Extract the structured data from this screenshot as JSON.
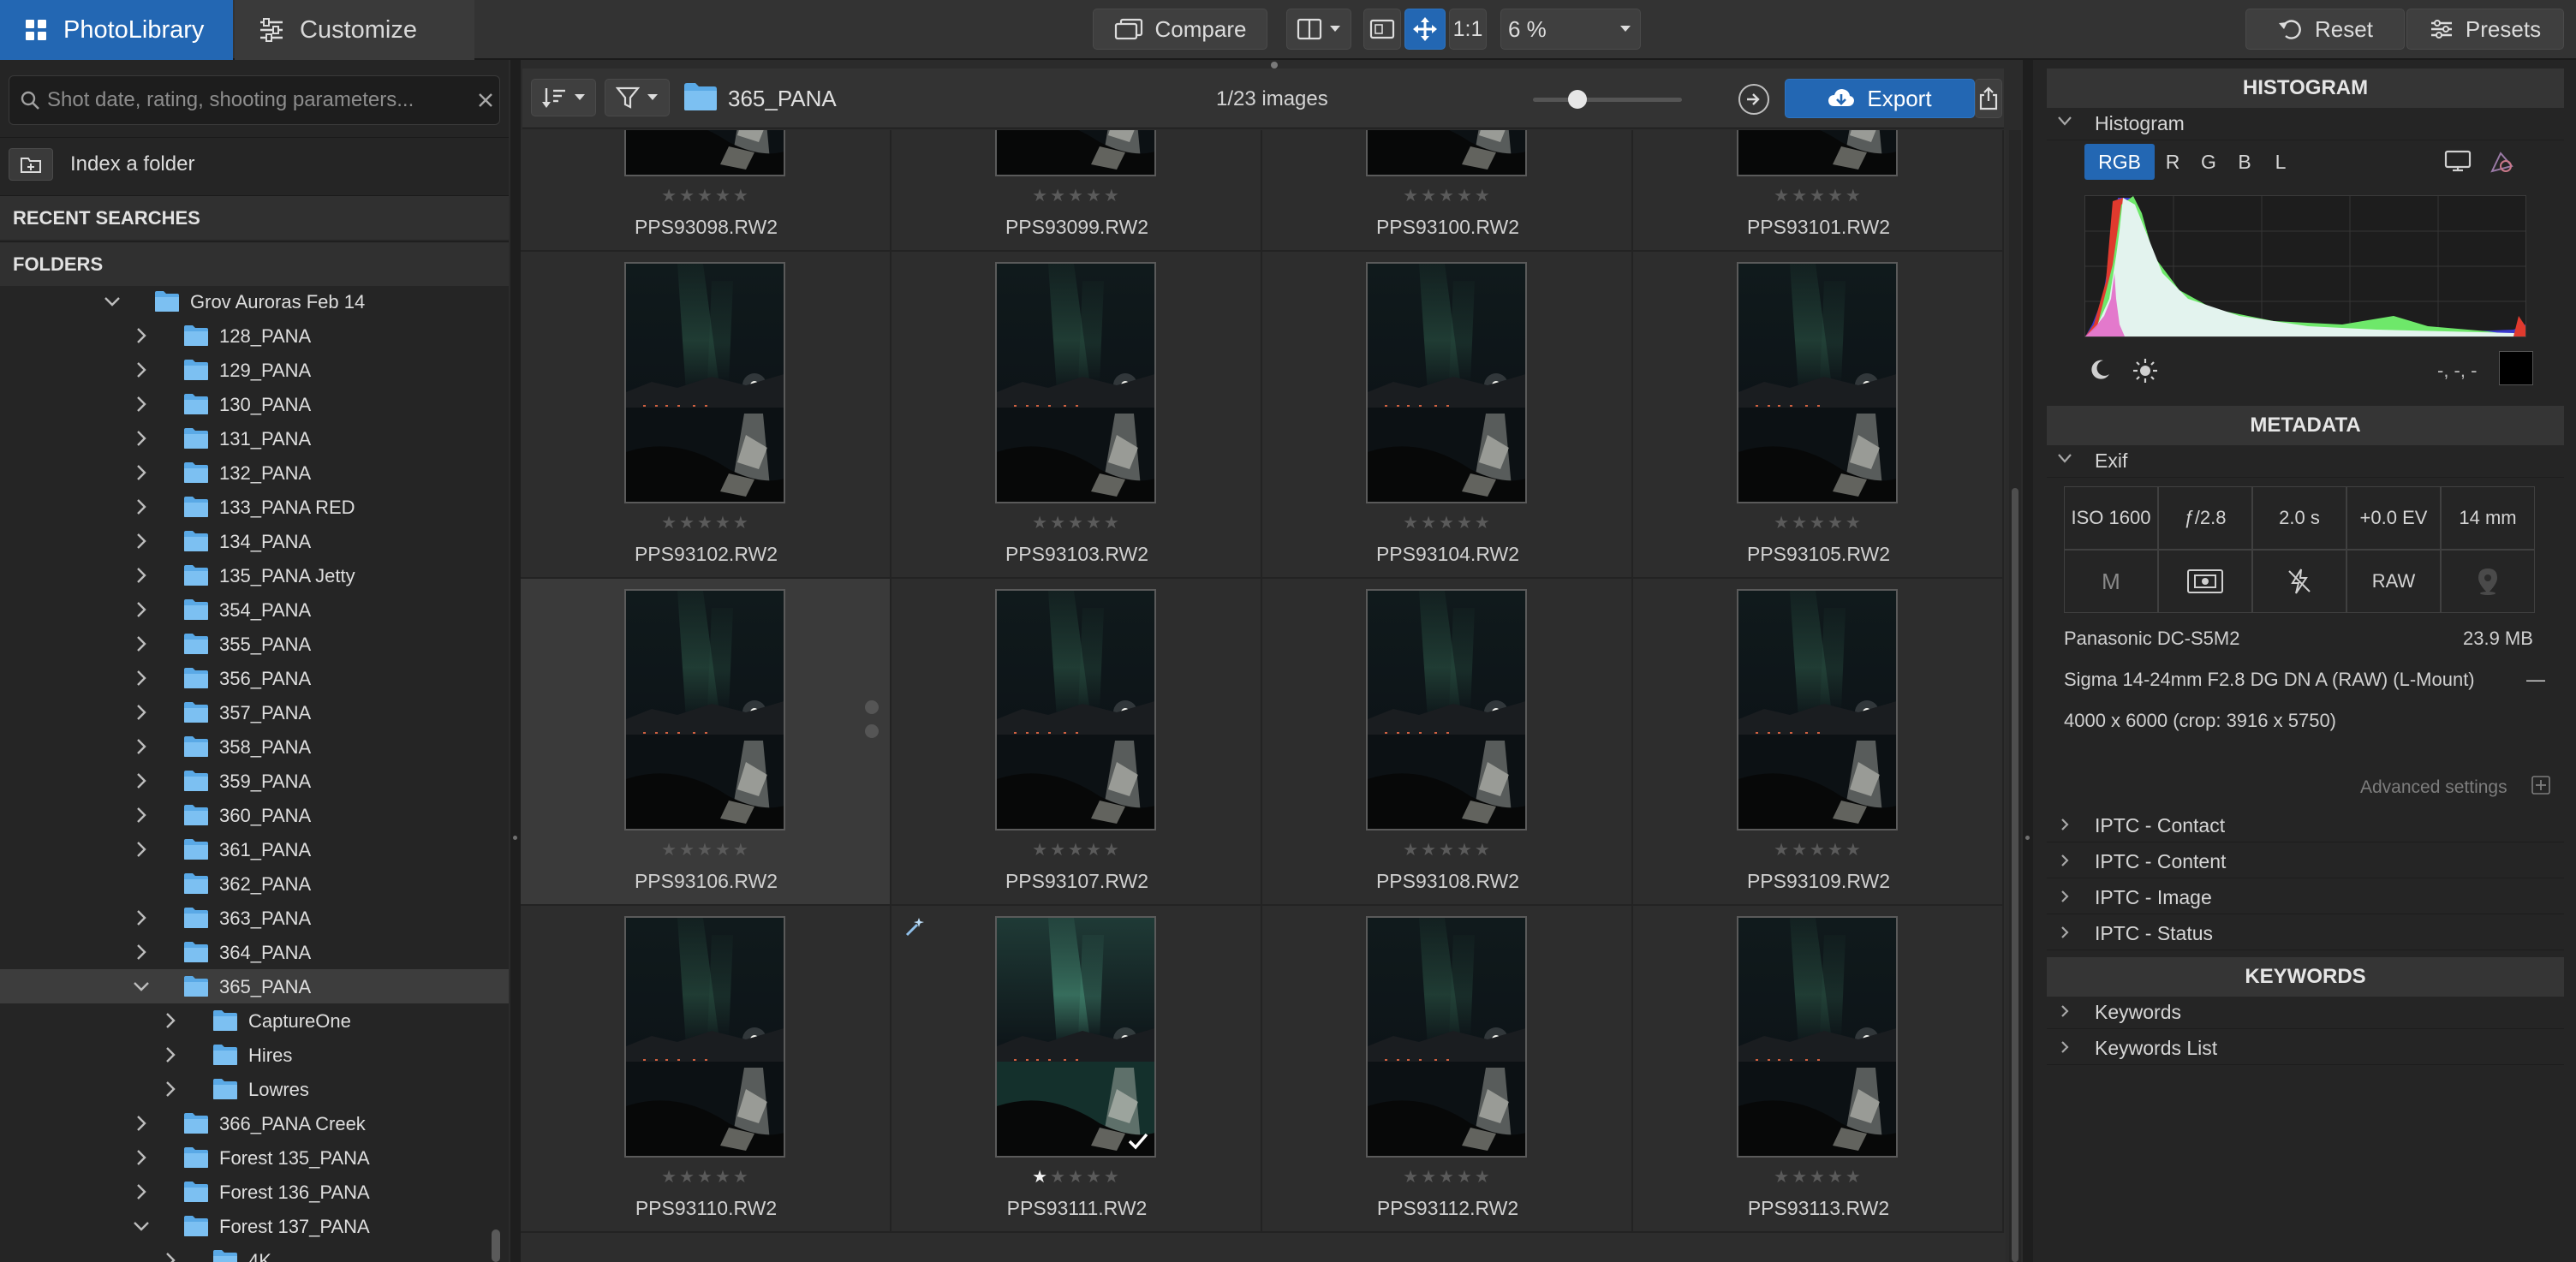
{
  "topbar": {
    "tabs": [
      {
        "label": "PhotoLibrary",
        "icon": "grid-icon"
      },
      {
        "label": "Customize",
        "icon": "sliders-icon"
      }
    ],
    "compare_label": "Compare",
    "one_to_one_label": "1:1",
    "zoom_value": "6 %",
    "reset_label": "Reset",
    "presets_label": "Presets"
  },
  "left": {
    "search_placeholder": "Shot date, rating, shooting parameters...",
    "index_folder_label": "Index a folder",
    "recent_searches_label": "RECENT SEARCHES",
    "folders_label": "FOLDERS",
    "tree": [
      {
        "label": "Grov Auroras Feb 14",
        "depth": 0,
        "expanded": true
      },
      {
        "label": "128_PANA",
        "depth": 1,
        "expanded": false
      },
      {
        "label": "129_PANA",
        "depth": 1,
        "expanded": false
      },
      {
        "label": "130_PANA",
        "depth": 1,
        "expanded": false
      },
      {
        "label": "131_PANA",
        "depth": 1,
        "expanded": false
      },
      {
        "label": "132_PANA",
        "depth": 1,
        "expanded": false
      },
      {
        "label": "133_PANA RED",
        "depth": 1,
        "expanded": false
      },
      {
        "label": "134_PANA",
        "depth": 1,
        "expanded": false
      },
      {
        "label": "135_PANA Jetty",
        "depth": 1,
        "expanded": false
      },
      {
        "label": "354_PANA",
        "depth": 1,
        "expanded": false
      },
      {
        "label": "355_PANA",
        "depth": 1,
        "expanded": false
      },
      {
        "label": "356_PANA",
        "depth": 1,
        "expanded": false
      },
      {
        "label": "357_PANA",
        "depth": 1,
        "expanded": false
      },
      {
        "label": "358_PANA",
        "depth": 1,
        "expanded": false
      },
      {
        "label": "359_PANA",
        "depth": 1,
        "expanded": false
      },
      {
        "label": "360_PANA",
        "depth": 1,
        "expanded": false
      },
      {
        "label": "361_PANA",
        "depth": 1,
        "expanded": false
      },
      {
        "label": "362_PANA",
        "depth": 1,
        "expanded": null
      },
      {
        "label": "363_PANA",
        "depth": 1,
        "expanded": false
      },
      {
        "label": "364_PANA",
        "depth": 1,
        "expanded": false
      },
      {
        "label": "365_PANA",
        "depth": 1,
        "expanded": true,
        "selected": true
      },
      {
        "label": "CaptureOne",
        "depth": 2,
        "expanded": false
      },
      {
        "label": "Hires",
        "depth": 2,
        "expanded": false
      },
      {
        "label": "Lowres",
        "depth": 2,
        "expanded": false
      },
      {
        "label": "366_PANA Creek",
        "depth": 1,
        "expanded": false
      },
      {
        "label": "Forest 135_PANA",
        "depth": 1,
        "expanded": false
      },
      {
        "label": "Forest 136_PANA",
        "depth": 1,
        "expanded": false
      },
      {
        "label": "Forest 137_PANA",
        "depth": 1,
        "expanded": true
      },
      {
        "label": "4K",
        "depth": 2,
        "expanded": false
      }
    ]
  },
  "center": {
    "folder_name": "365_PANA",
    "image_count": "1/23 images",
    "thumb_size": 0.3,
    "export_label": "Export",
    "images": [
      {
        "name": "PPS93098.RW2",
        "rating": 0
      },
      {
        "name": "PPS93099.RW2",
        "rating": 0
      },
      {
        "name": "PPS93100.RW2",
        "rating": 0
      },
      {
        "name": "PPS93101.RW2",
        "rating": 0
      },
      {
        "name": "PPS93102.RW2",
        "rating": 0
      },
      {
        "name": "PPS93103.RW2",
        "rating": 0
      },
      {
        "name": "PPS93104.RW2",
        "rating": 0
      },
      {
        "name": "PPS93105.RW2",
        "rating": 0
      },
      {
        "name": "PPS93106.RW2",
        "rating": 0
      },
      {
        "name": "PPS93107.RW2",
        "rating": 0
      },
      {
        "name": "PPS93108.RW2",
        "rating": 0
      },
      {
        "name": "PPS93109.RW2",
        "rating": 0
      },
      {
        "name": "PPS93110.RW2",
        "rating": 0
      },
      {
        "name": "PPS93111.RW2",
        "rating": 1,
        "checked": true,
        "edited": true
      },
      {
        "name": "PPS93112.RW2",
        "rating": 0
      },
      {
        "name": "PPS93113.RW2",
        "rating": 0
      }
    ]
  },
  "right": {
    "histogram_header": "HISTOGRAM",
    "histogram_label": "Histogram",
    "channels": [
      "RGB",
      "R",
      "G",
      "B",
      "L"
    ],
    "active_channel": "RGB",
    "color_readout": "-, -, -",
    "metadata_header": "METADATA",
    "exif_label": "Exif",
    "exif": {
      "iso": "ISO 1600",
      "aperture": "ƒ/2.8",
      "shutter": "2.0 s",
      "ev": "+0.0 EV",
      "focal": "14 mm",
      "mode": "M",
      "format": "RAW"
    },
    "camera": "Panasonic DC-S5M2",
    "file_size": "23.9 MB",
    "lens": "Sigma 14-24mm F2.8 DG DN A (RAW) (L-Mount)",
    "lens_dash": "—",
    "dimensions": "4000 x 6000  (crop: 3916 x 5750)",
    "advanced_settings": "Advanced settings",
    "iptc": [
      "IPTC - Contact",
      "IPTC - Content",
      "IPTC - Image",
      "IPTC - Status"
    ],
    "keywords_header": "KEYWORDS",
    "keywords": [
      "Keywords",
      "Keywords List"
    ]
  },
  "colors": {
    "accent": "#2367b3",
    "panel": "#252525",
    "folder": "#5aa9e6"
  }
}
